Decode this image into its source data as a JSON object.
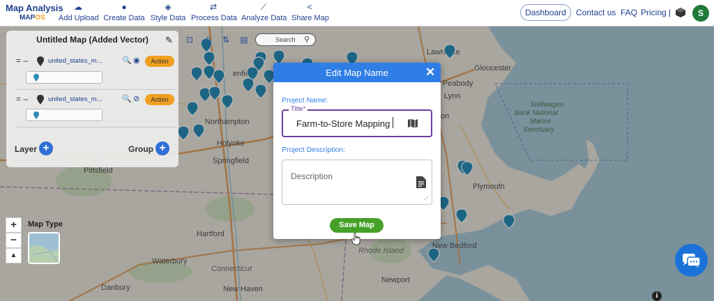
{
  "app": {
    "title": "Map Analysis",
    "logo_sub_a": "MAP",
    "logo_sub_b": "OS"
  },
  "nav": [
    {
      "label": "Add Upload",
      "icon": "cloud-upload-icon"
    },
    {
      "label": "Create Data",
      "icon": "map-pin-icon"
    },
    {
      "label": "Style Data",
      "icon": "paint-bucket-icon"
    },
    {
      "label": "Process Data",
      "icon": "process-icon"
    },
    {
      "label": "Analyze Data",
      "icon": "analyze-chart-icon"
    },
    {
      "label": "Share Map",
      "icon": "share-icon"
    }
  ],
  "header_right": {
    "dashboard": "Dashboard",
    "contact": "Contact us",
    "faq": "FAQ",
    "pricing": "Pricing |",
    "avatar_initial": "S"
  },
  "layer_panel": {
    "title": "Untitled Map (Added Vector)",
    "layers": [
      {
        "name": "united_states_m...",
        "action": "Action",
        "visible": true
      },
      {
        "name": "united_states_m...",
        "action": "Action",
        "visible": false
      }
    ],
    "layer_label": "Layer",
    "group_label": "Group"
  },
  "toolbar": {
    "search_placeholder": "Search"
  },
  "map_controls": {
    "zoom_in": "+",
    "zoom_out": "−",
    "map_type_label": "Map Type"
  },
  "map_labels": [
    {
      "text": "Lawrence"
    },
    {
      "text": "Gloucester"
    },
    {
      "text": "Peabody"
    },
    {
      "text": "Lynn"
    },
    {
      "text": "Stellwagen Bank National Marine Sanctuary"
    },
    {
      "text": "Northampton"
    },
    {
      "text": "Holyoke"
    },
    {
      "text": "Springfield"
    },
    {
      "text": "Plymouth"
    },
    {
      "text": "New Bedford"
    },
    {
      "text": "Rhode Island"
    },
    {
      "text": "Hartford"
    },
    {
      "text": "Waterbury"
    },
    {
      "text": "Connecticut"
    },
    {
      "text": "New Haven"
    },
    {
      "text": "Danbury"
    },
    {
      "text": "Newport"
    },
    {
      "text": "Pittsfield"
    }
  ],
  "modal": {
    "title": "Edit Map Name",
    "project_name_label": "Project Name:",
    "title_legend": "Title*",
    "title_value": "Farm-to-Store Mapping",
    "project_description_label": "Project Description:",
    "description_placeholder": "Description",
    "save_button": "Save Map"
  },
  "colors": {
    "brand": "#1f3f8f",
    "modal_header": "#2f7ee6",
    "save_green": "#46a028",
    "action_orange": "#f0a020",
    "focus_purple": "#6b3fa0",
    "pin_teal": "#2a8cb8"
  }
}
